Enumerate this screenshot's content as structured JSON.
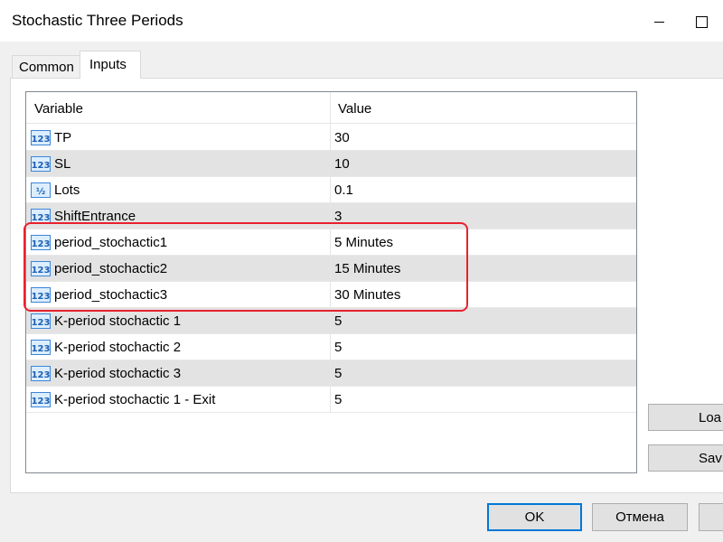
{
  "window": {
    "title": "Stochastic Three Periods"
  },
  "tabs": [
    {
      "label": "Common",
      "active": false
    },
    {
      "label": "Inputs",
      "active": true
    }
  ],
  "grid": {
    "columns": [
      "Variable",
      "Value"
    ],
    "rows": [
      {
        "icon": "integer-123-icon",
        "variable": "TP",
        "value": "30"
      },
      {
        "icon": "integer-123-icon",
        "variable": "SL",
        "value": "10"
      },
      {
        "icon": "fraction-half-icon",
        "variable": "Lots",
        "value": "0.1"
      },
      {
        "icon": "integer-123-icon",
        "variable": "ShiftEntrance",
        "value": "3"
      },
      {
        "icon": "integer-123-icon",
        "variable": "period_stochactic1",
        "value": "5 Minutes"
      },
      {
        "icon": "integer-123-icon",
        "variable": "period_stochactic2",
        "value": "15 Minutes"
      },
      {
        "icon": "integer-123-icon",
        "variable": "period_stochactic3",
        "value": "30 Minutes"
      },
      {
        "icon": "integer-123-icon",
        "variable": "K-period stochactic 1",
        "value": "5"
      },
      {
        "icon": "integer-123-icon",
        "variable": "K-period stochactic 2",
        "value": "5"
      },
      {
        "icon": "integer-123-icon",
        "variable": "K-period stochactic 3",
        "value": "5"
      },
      {
        "icon": "integer-123-icon",
        "variable": "K-period stochactic 1 - Exit",
        "value": "5"
      }
    ]
  },
  "side_buttons": {
    "load": "Loa",
    "save": "Sav"
  },
  "footer": {
    "ok": "OK",
    "cancel": "Отмена"
  },
  "colors": {
    "highlight": "#e8212e",
    "default_button_border": "#0078d7",
    "alt_row": "#e3e3e3"
  }
}
